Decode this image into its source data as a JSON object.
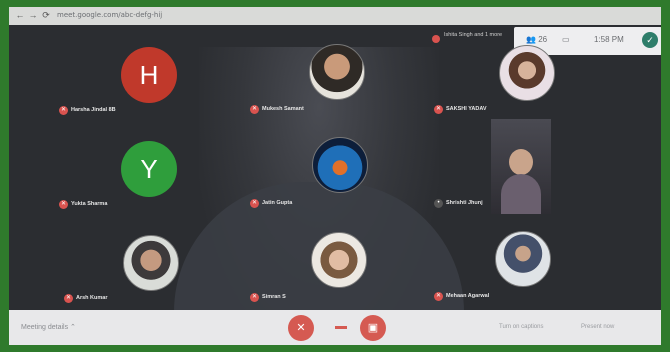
{
  "browser": {
    "url": "meet.google.com/abc-defg-hij",
    "controls": [
      "←",
      "→",
      "⟳"
    ]
  },
  "notice": {
    "text": "Ishita Singh and 1 more"
  },
  "status": {
    "people": "26",
    "chat": "▭",
    "time": "1:58 PM"
  },
  "participants": [
    {
      "initial": "H",
      "name": "Harsha Jindal 8B",
      "color": "#c0392b"
    },
    {
      "name": "Mukesh Samant"
    },
    {
      "name": "SAKSHI YADAV"
    },
    {
      "initial": "Y",
      "name": "Yukta Sharma",
      "color": "#2f9e3c"
    },
    {
      "name": "Jatin Gupta"
    },
    {
      "name": "Shrishti Jhunj"
    },
    {
      "name": "Arsh Kumar"
    },
    {
      "name": "Simran S"
    },
    {
      "name": "Mehaan Agarwal"
    }
  ],
  "bottom": {
    "details": "Meeting details ⌃",
    "present": "Present now",
    "captions": "Turn on captions"
  },
  "colors": {
    "frame": "#2f7a2c",
    "end_call": "#d55a52"
  }
}
